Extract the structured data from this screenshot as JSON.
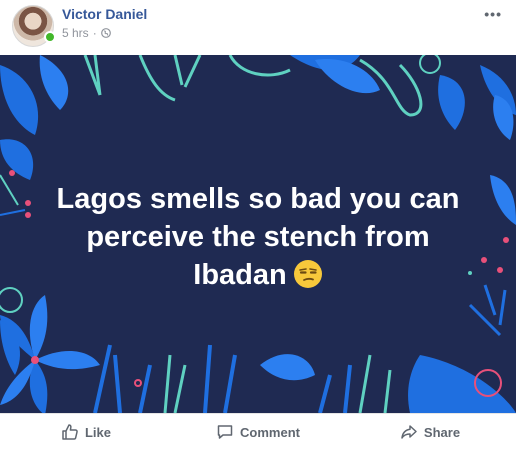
{
  "post": {
    "author": "Victor Daniel",
    "time": "5 hrs",
    "privacy_icon": "globe-icon",
    "more_icon": "more-options-icon",
    "caption_lines": [
      "Lagos smells so bad you can",
      "perceive the stench from",
      "Ibadan"
    ],
    "emoji": "unamused-face-emoji"
  },
  "actions": {
    "like": "Like",
    "comment": "Comment",
    "share": "Share"
  },
  "colors": {
    "author": "#365899",
    "image_background": "#1f2a52",
    "leaf_blue": "#1f6fe0",
    "leaf_teal": "#5fd1c1",
    "accent_pink": "#e8507a",
    "online": "#42b72a"
  }
}
